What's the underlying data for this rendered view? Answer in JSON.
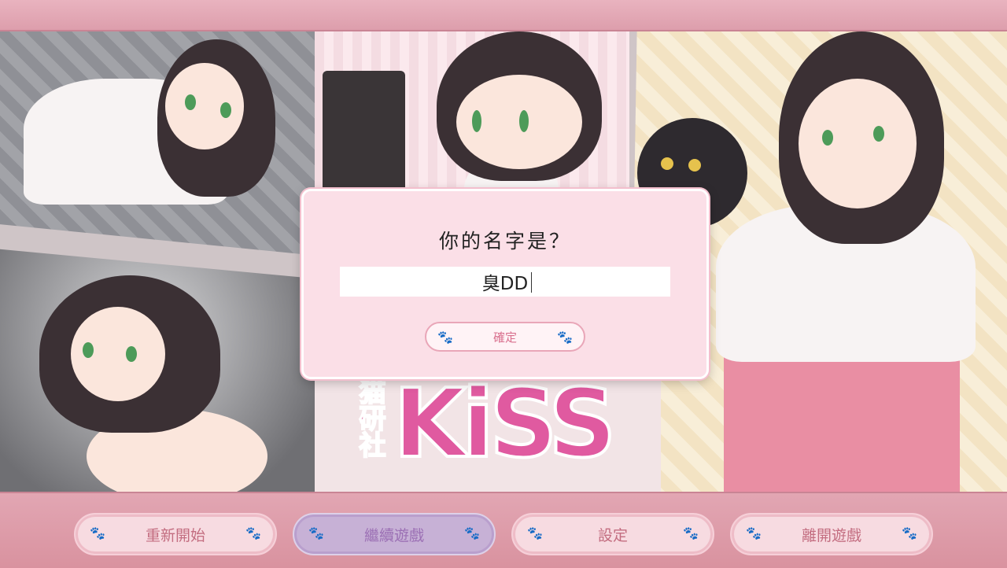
{
  "dialog": {
    "title": "你的名字是？",
    "name_value": "臭DD",
    "confirm_label": "確定"
  },
  "logo": {
    "kanji": "猫研社",
    "word": "KiSS"
  },
  "menu": {
    "items": [
      {
        "label": "重新開始",
        "active": false
      },
      {
        "label": "繼續遊戲",
        "active": true
      },
      {
        "label": "設定",
        "active": false
      },
      {
        "label": "離開遊戲",
        "active": false
      }
    ]
  },
  "icons": {
    "paw": "paw-icon"
  },
  "colors": {
    "frame_pink": "#e7a9b6",
    "dialog_bg": "#fbdfe7",
    "active_button": "#c7b1d6",
    "button_text": "#c36d80"
  }
}
